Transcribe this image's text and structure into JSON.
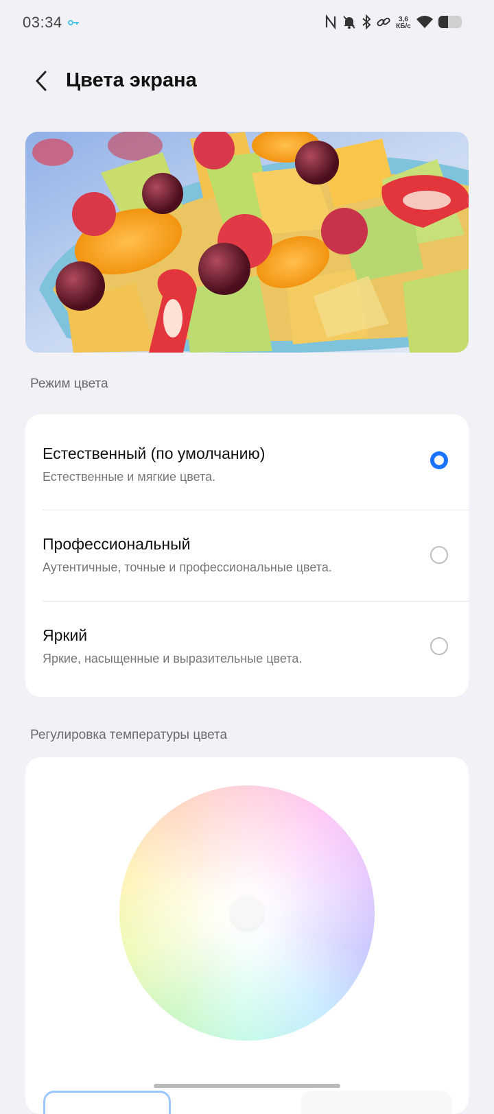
{
  "status_bar": {
    "time": "03:34",
    "net_speed_value": "3,6",
    "net_speed_unit": "КБ/с",
    "icons": [
      "vpn-key-icon",
      "nfc-icon",
      "mute-icon",
      "bluetooth-icon",
      "link-icon",
      "wifi-icon",
      "battery-icon"
    ]
  },
  "header": {
    "title": "Цвета экрана",
    "back_icon": "chevron-left-icon"
  },
  "color_mode": {
    "section_label": "Режим цвета",
    "options": [
      {
        "title": "Естественный (по умолчанию)",
        "description": "Естественные и мягкие цвета.",
        "selected": true
      },
      {
        "title": "Профессиональный",
        "description": "Аутентичные, точные и профессиональные цвета.",
        "selected": false
      },
      {
        "title": "Яркий",
        "description": "Яркие, насыщенные и выразительные цвета.",
        "selected": false
      }
    ]
  },
  "temperature": {
    "section_label": "Регулировка температуры цвета"
  },
  "colors": {
    "accent": "#1a73ff",
    "background": "#f2f1f6",
    "card": "#ffffff"
  }
}
